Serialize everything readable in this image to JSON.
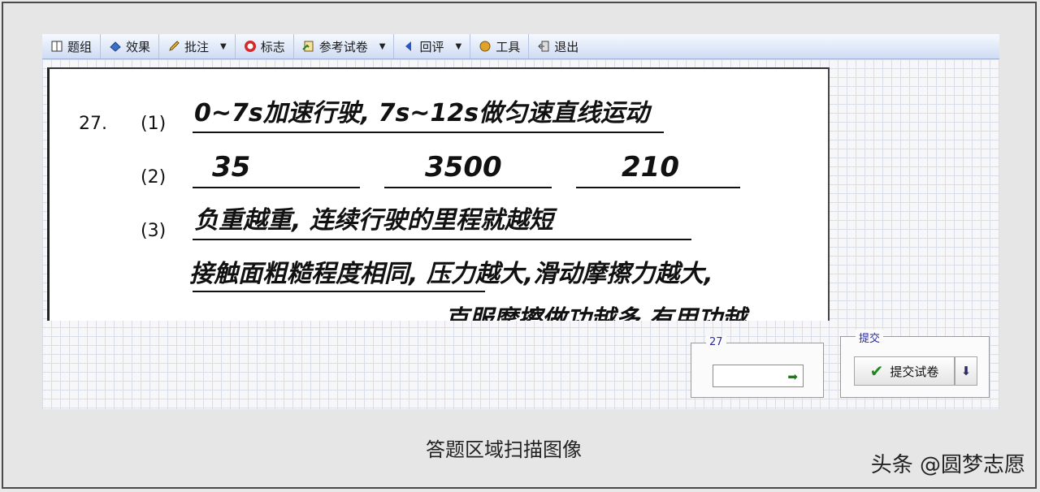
{
  "toolbar": {
    "items": [
      {
        "label": "题组",
        "icon": "question-group-icon"
      },
      {
        "label": "效果",
        "icon": "effect-icon"
      },
      {
        "label": "批注",
        "icon": "pencil-icon"
      },
      {
        "label": "标志",
        "icon": "mark-icon"
      },
      {
        "label": "参考试卷",
        "icon": "reference-paper-icon"
      },
      {
        "label": "回评",
        "icon": "back-arrow-icon"
      },
      {
        "label": "工具",
        "icon": "tool-icon"
      },
      {
        "label": "退出",
        "icon": "exit-icon"
      }
    ]
  },
  "scan": {
    "question_number": "27.",
    "parts": [
      {
        "label": "(1)",
        "answer": "0~7s加速行驶, 7s~12s做匀速直线运动"
      },
      {
        "label": "(2)",
        "answers": [
          "35",
          "3500",
          "210"
        ]
      },
      {
        "label": "(3)",
        "lines": [
          "负重越重, 连续行驶的里程就越短",
          "接触面粗糙程度相同, 压力越大,滑动摩擦力越大,",
          "克服摩擦做功越多,有用功越..."
        ]
      }
    ]
  },
  "jump_panel": {
    "legend": "27",
    "value": ""
  },
  "submit_panel": {
    "legend": "提交",
    "button_label": "提交试卷"
  },
  "caption": "答题区域扫描图像",
  "watermark": "头条 @圆梦志愿",
  "colors": {
    "toolbar_top": "#f6f9ff",
    "toolbar_bottom": "#cfdcf3",
    "legend": "#2b2b9a",
    "check": "#1c8a1c"
  }
}
